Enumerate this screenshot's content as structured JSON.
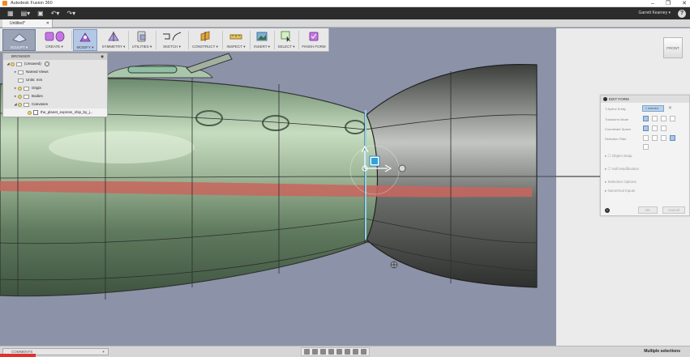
{
  "window": {
    "title": "Autodesk Fusion 360"
  },
  "user": {
    "name": "Garrett Kearney ▾"
  },
  "help": {
    "glyph": "?"
  },
  "document": {
    "tab_label": "Untitled*"
  },
  "toolbar": {
    "workspace": "SCULPT ▾",
    "menus": [
      "CREATE ▾",
      "MODIFY ▾",
      "SYMMETRY ▾",
      "UTILITIES ▾",
      "SKETCH ▾",
      "CONSTRUCT ▾",
      "INSPECT ▾",
      "INSERT ▾",
      "SELECT ▾",
      "FINISH FORM"
    ]
  },
  "browser": {
    "title": "BROWSER",
    "root": "(Unsaved)",
    "items": [
      "Named Views",
      "Units: mm",
      "Origin",
      "Bodies",
      "Canvases",
      "the_planet_express_ship_by_j..."
    ]
  },
  "viewcube": {
    "label": "FRONT"
  },
  "edit_form": {
    "title": "EDIT FORM",
    "rows": [
      "T-Spline Entity",
      "Transform Mode",
      "Coordinate Space",
      "Selection Filter"
    ],
    "sections": [
      "Object Snap",
      "Soft Modification",
      "Selection Options",
      "Numerical Inputs"
    ],
    "ok": "OK",
    "cancel": "Cancel"
  },
  "comments": {
    "label": "COMMENTS",
    "add": "+"
  },
  "status": {
    "text": "Multiple selections"
  }
}
